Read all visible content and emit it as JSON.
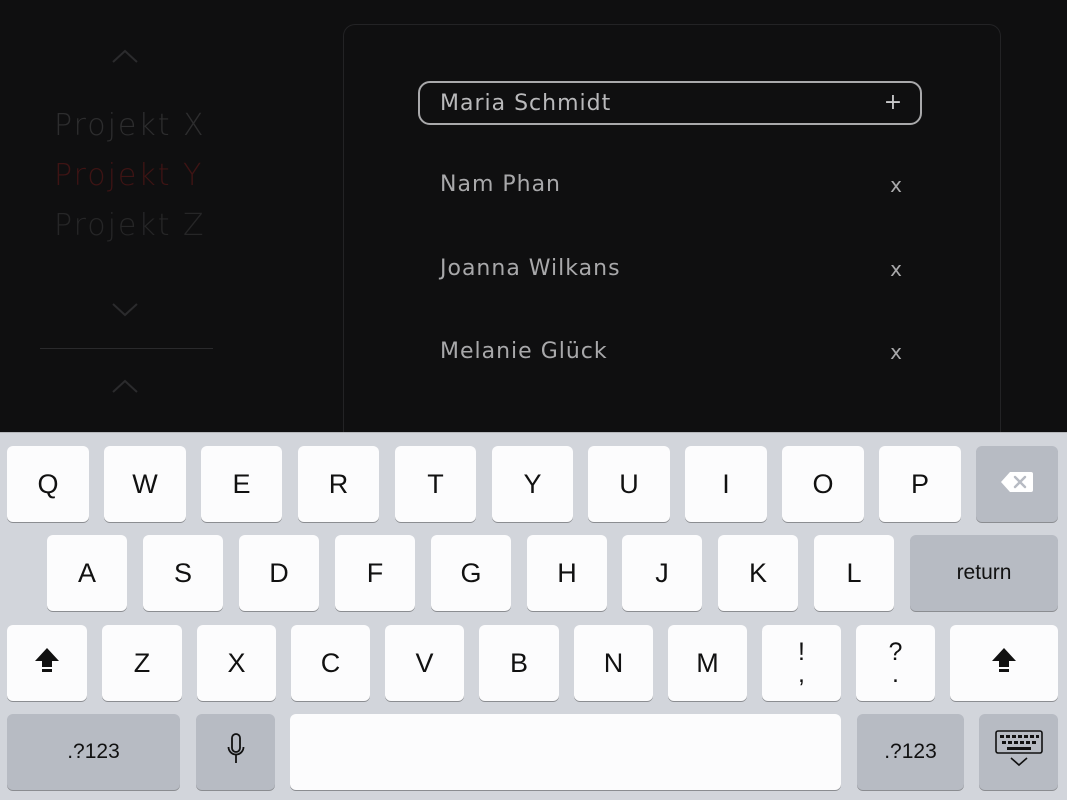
{
  "projects": {
    "items": [
      {
        "label": "Projekt X",
        "color": "#2d2d2e"
      },
      {
        "label": "Projekt Y",
        "color": "#3e1414"
      },
      {
        "label": "Projekt Z",
        "color": "#262627"
      }
    ],
    "up_icon": "chevron-up-icon",
    "down_icon": "chevron-down-icon"
  },
  "members": {
    "input_value": "Maria Schmidt",
    "add_label": "+",
    "list": [
      {
        "name": "Nam Phan",
        "remove_label": "x"
      },
      {
        "name": "Joanna Wilkans",
        "remove_label": "x"
      },
      {
        "name": "Melanie Glück",
        "remove_label": "x"
      }
    ]
  },
  "keyboard": {
    "row1": [
      "Q",
      "W",
      "E",
      "R",
      "T",
      "Y",
      "U",
      "I",
      "O",
      "P"
    ],
    "row2": [
      "A",
      "S",
      "D",
      "F",
      "G",
      "H",
      "J",
      "K",
      "L"
    ],
    "row3": [
      "Z",
      "X",
      "C",
      "V",
      "B",
      "N",
      "M"
    ],
    "punct1": [
      "!",
      ","
    ],
    "punct2": [
      "?",
      "."
    ],
    "return_label": "return",
    "numbers_left": ".?123",
    "numbers_right": ".?123",
    "icons": {
      "delete": "backspace-icon",
      "shift": "shift-icon",
      "mic": "microphone-icon",
      "hide": "keyboard-dismiss-icon"
    }
  },
  "colors": {
    "background": "#0f0f10",
    "accent_red": "#3e1414",
    "keyboard_bg": "#d2d5db"
  }
}
